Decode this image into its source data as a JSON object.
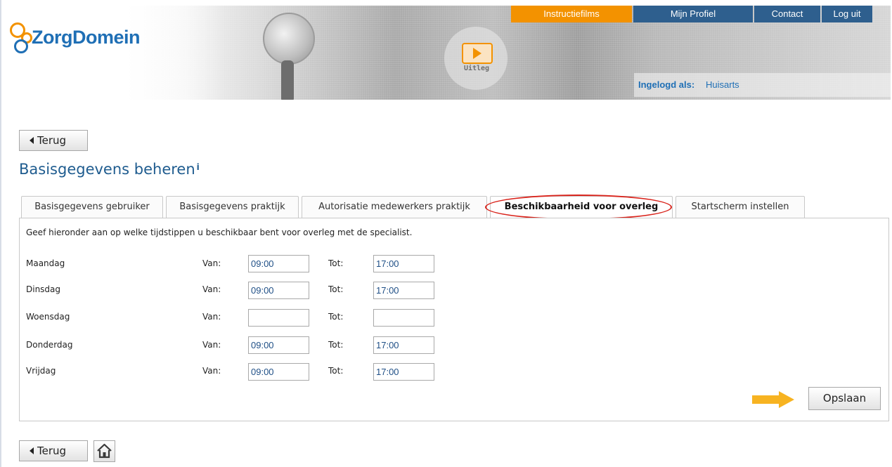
{
  "header": {
    "logo_text": "ZorgDomein",
    "uitleg_label": "Uitleg",
    "nav": [
      {
        "label": "Instructiefilms",
        "active": true
      },
      {
        "label": "Mijn Profiel"
      },
      {
        "label": "Contact"
      },
      {
        "label": "Log uit"
      }
    ],
    "logged_in_prefix": "Ingelogd als:",
    "logged_in_user": "Huisarts"
  },
  "back_label": "Terug",
  "page": {
    "title": "Basisgegevens beheren",
    "info_marker": "i"
  },
  "tabs": [
    {
      "label": "Basisgegevens gebruiker"
    },
    {
      "label": "Basisgegevens praktijk"
    },
    {
      "label": "Autorisatie medewerkers praktijk"
    },
    {
      "label": "Beschikbaarheid voor overleg",
      "active": true
    },
    {
      "label": "Startscherm instellen"
    }
  ],
  "availability": {
    "intro": "Geef hieronder aan op welke tijdstippen u beschikbaar bent voor overleg met de specialist.",
    "van_label": "Van:",
    "tot_label": "Tot:",
    "days": [
      {
        "day": "Maandag",
        "van": "09:00",
        "tot": "17:00"
      },
      {
        "day": "Dinsdag",
        "van": "09:00",
        "tot": "17:00"
      },
      {
        "day": "Woensdag",
        "van": "",
        "tot": ""
      },
      {
        "day": "Donderdag",
        "van": "09:00",
        "tot": "17:00"
      },
      {
        "day": "Vrijdag",
        "van": "09:00",
        "tot": "17:00"
      }
    ],
    "save_label": "Opslaan"
  },
  "colors": {
    "brand_blue": "#1f6fb5",
    "nav_orange": "#f39200",
    "nav_blue": "#2e5f8e",
    "highlight_red": "#d9241c",
    "arrow_yellow": "#f7b321"
  },
  "icons": [
    "play-icon",
    "back-arrow-icon",
    "home-icon",
    "pointer-arrow-icon"
  ]
}
